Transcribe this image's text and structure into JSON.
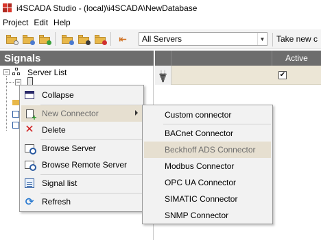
{
  "window": {
    "title": "i4SCADA Studio - (local)\\i4SCADA\\NewDatabase"
  },
  "menubar": {
    "items": [
      "Project",
      "Edit",
      "Help"
    ]
  },
  "toolbar": {
    "servers_select": {
      "value": "All Servers"
    },
    "take_new_label": "Take new c"
  },
  "signals": {
    "title": "Signals",
    "tree": {
      "root_label": "Server List"
    }
  },
  "grid": {
    "columns": [
      "Active"
    ],
    "rows": [
      {
        "active": true,
        "active_mark": "✔"
      }
    ]
  },
  "context_menu": {
    "items": [
      {
        "label": "Collapse",
        "icon": "collapse-icon"
      },
      {
        "label": "New Connector",
        "icon": "new-connector-icon",
        "has_submenu": true,
        "highlighted": true
      },
      {
        "label": "Delete",
        "icon": "delete-icon"
      },
      {
        "label": "Browse Server",
        "icon": "browse-server-icon"
      },
      {
        "label": "Browse Remote Server",
        "icon": "browse-remote-server-icon"
      },
      {
        "label": "Signal list",
        "icon": "signal-list-icon"
      },
      {
        "label": "Refresh",
        "icon": "refresh-icon"
      }
    ]
  },
  "submenu": {
    "items": [
      {
        "label": "Custom connector"
      },
      {
        "label": "BACnet Connector"
      },
      {
        "label": "Beckhoff ADS Connector",
        "highlighted": true
      },
      {
        "label": "Modbus Connector"
      },
      {
        "label": "OPC UA Connector"
      },
      {
        "label": "SIMATIC Connector"
      },
      {
        "label": "SNMP Connector"
      }
    ]
  },
  "colors": {
    "panel_header": "#6d6d6d",
    "highlight": "#e6dfd0",
    "row_selected": "#ece6d6",
    "app_icon": "#d9362b"
  }
}
